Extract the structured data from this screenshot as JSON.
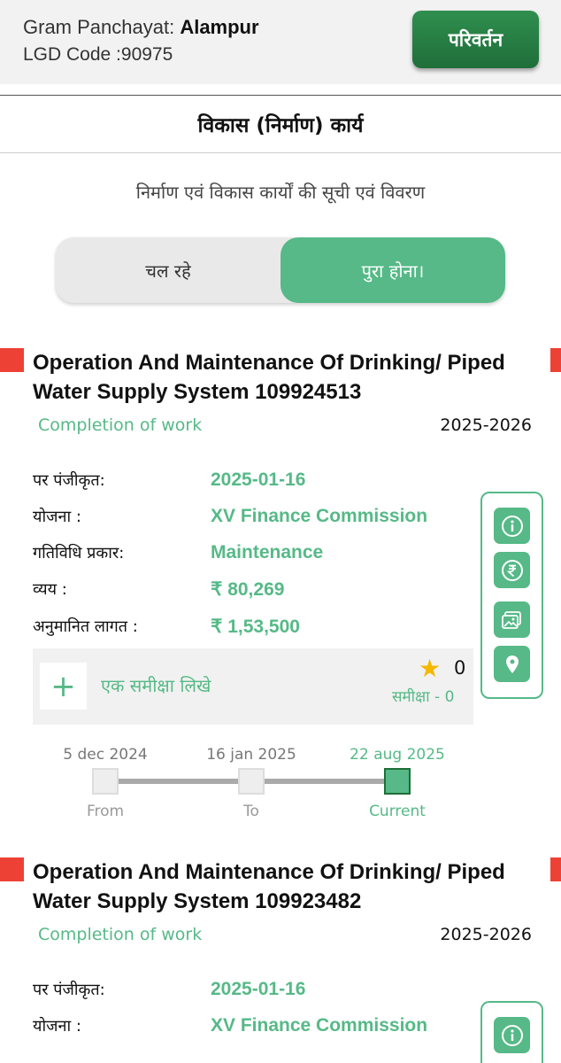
{
  "header": {
    "gp_label": "Gram Panchayat: ",
    "gp_name": "Alampur",
    "lgd_label": "LGD Code :",
    "lgd_code": "90975",
    "change_button": "परिवर्तन"
  },
  "page_title": "विकास (निर्माण) कार्य",
  "subtitle": "निर्माण एवं विकास कार्यों की सूची एवं विवरण",
  "tabs": {
    "running": "चल रहे",
    "completed": "पुरा होना।",
    "selected": "completed"
  },
  "labels": {
    "registered": "पर पंजीकृत:",
    "scheme": "योजना :",
    "activity_type": "गतिविधि प्रकार:",
    "expense": "व्यय :",
    "estimated_cost": "अनुमानित लागत :",
    "write_review": "एक समीक्षा लिखे",
    "review_prefix": "समीक्षा - ",
    "from": "From",
    "to": "To",
    "current": "Current"
  },
  "works": [
    {
      "title": "Operation And Maintenance Of Drinking/ Piped Water Supply System  109924513",
      "status": "Completion of work",
      "year": "2025-2026",
      "registered": "2025-01-16",
      "scheme": "XV Finance Commission",
      "activity_type": "Maintenance",
      "expense": "₹ 80,269",
      "estimated_cost": "₹ 1,53,500",
      "rating": "0",
      "review_count": "0",
      "timeline": {
        "from": "5 dec 2024",
        "to": "16 jan 2025",
        "current": "22 aug 2025"
      }
    },
    {
      "title": "Operation And Maintenance Of Drinking/ Piped Water Supply System  109923482",
      "status": "Completion of work",
      "year": "2025-2026",
      "registered": "2025-01-16",
      "scheme": "XV Finance Commission"
    }
  ],
  "icons": {
    "info": "info-icon",
    "rupee": "rupee-icon",
    "gallery": "gallery-icon",
    "location": "location-pin-icon",
    "star": "star-icon",
    "plus": "plus-icon"
  },
  "colors": {
    "accent": "#56b987",
    "button_dark": "#1f6e39",
    "marker": "#ee4135",
    "star": "#f5b800"
  }
}
